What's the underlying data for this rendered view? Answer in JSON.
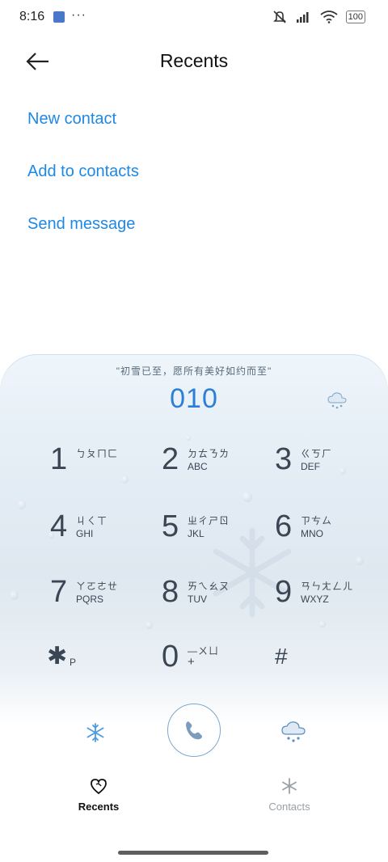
{
  "status_bar": {
    "time": "8:16",
    "dots": "···",
    "battery": "100",
    "icons": [
      "app-notification-icon",
      "mute-icon",
      "signal-icon",
      "wifi-icon",
      "battery-icon"
    ]
  },
  "header": {
    "title": "Recents",
    "back_icon": "arrow-left-icon"
  },
  "actions": {
    "new_contact": "New contact",
    "add_to_contacts": "Add to contacts",
    "send_message": "Send message"
  },
  "dialer": {
    "slogan": "\"初雪已至，愿所有美好如约而至\"",
    "number": "010",
    "accent_color": "#2b7fd6",
    "keys": [
      {
        "digit": "1",
        "zhuyin": "ㄅㄆㄇㄈ",
        "letters": ""
      },
      {
        "digit": "2",
        "zhuyin": "ㄉㄊㄋㄌ",
        "letters": "ABC"
      },
      {
        "digit": "3",
        "zhuyin": "ㄍㄎㄏ",
        "letters": "DEF"
      },
      {
        "digit": "4",
        "zhuyin": "ㄐㄑㄒ",
        "letters": "GHI"
      },
      {
        "digit": "5",
        "zhuyin": "ㄓㄔㄕㄖ",
        "letters": "JKL"
      },
      {
        "digit": "6",
        "zhuyin": "ㄗㄘㄙ",
        "letters": "MNO"
      },
      {
        "digit": "7",
        "zhuyin": "ㄚㄛㄜㄝ",
        "letters": "PQRS"
      },
      {
        "digit": "8",
        "zhuyin": "ㄞㄟㄠㄡ",
        "letters": "TUV"
      },
      {
        "digit": "9",
        "zhuyin": "ㄢㄣㄤㄥㄦ",
        "letters": "WXYZ"
      },
      {
        "digit": "✱",
        "zhuyin": "",
        "letters": "P"
      },
      {
        "digit": "0",
        "zhuyin": "—ㄨㄩ",
        "letters": "+"
      },
      {
        "digit": "#",
        "zhuyin": "",
        "letters": ""
      }
    ]
  },
  "bottom_actions": {
    "left_icon": "snowflake-icon",
    "call_icon": "phone-icon",
    "right_icon": "snow-cloud-icon"
  },
  "nav": {
    "recents": "Recents",
    "contacts": "Contacts"
  }
}
